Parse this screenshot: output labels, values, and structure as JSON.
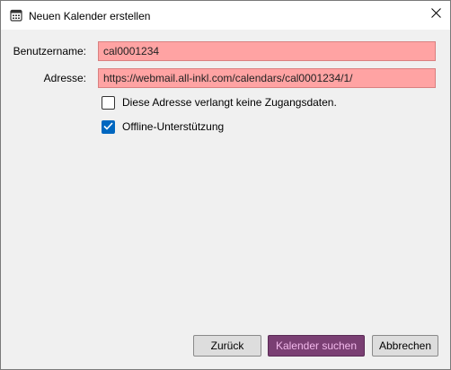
{
  "window": {
    "title": "Neuen Kalender erstellen",
    "icon": "calendar-icon",
    "close_icon": "close-icon"
  },
  "form": {
    "username": {
      "label": "Benutzername:",
      "value": "cal0001234"
    },
    "address": {
      "label": "Adresse:",
      "value": "https://webmail.all-inkl.com/calendars/cal0001234/1/"
    },
    "no_credentials": {
      "label": "Diese Adresse verlangt keine Zugangsdaten.",
      "checked": false
    },
    "offline_support": {
      "label": "Offline-Unterstützung",
      "checked": true
    }
  },
  "buttons": {
    "back": "Zurück",
    "search": "Kalender suchen",
    "cancel": "Abbrechen"
  },
  "colors": {
    "invalid_field_bg": "#ffa3a3",
    "primary_button_bg": "#7a3f73",
    "primary_button_text": "#f3b9ec",
    "checkbox_accent": "#0067c0"
  }
}
